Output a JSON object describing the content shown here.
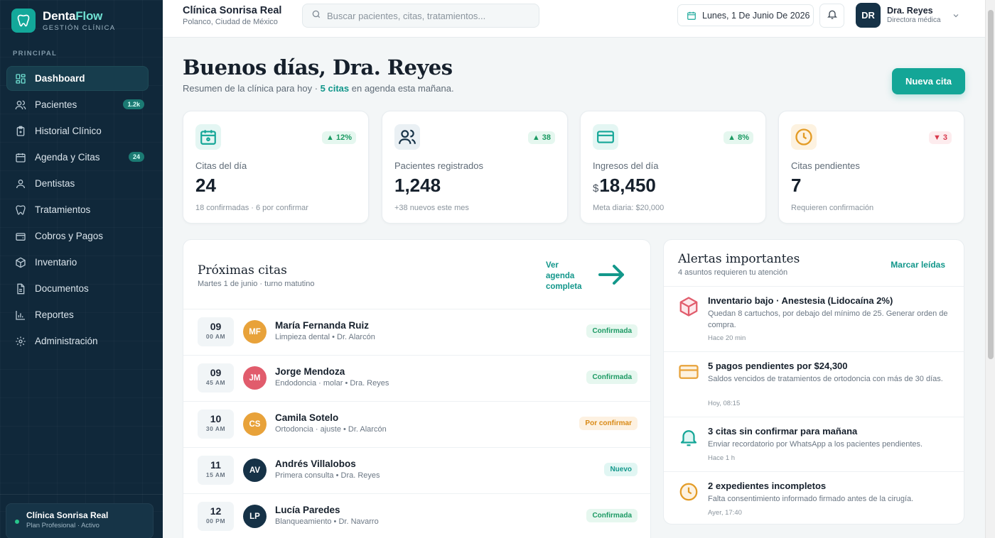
{
  "brand": {
    "name_main": "Denta",
    "name_accent": "Flow",
    "subtitle": "GESTIÓN CLÍNICA"
  },
  "sidebar": {
    "section_label": "PRINCIPAL",
    "items": [
      {
        "label": "Dashboard",
        "icon": "dashboard-icon",
        "active": true
      },
      {
        "label": "Pacientes",
        "icon": "users-icon",
        "badge": "1.2k"
      },
      {
        "label": "Historial Clínico",
        "icon": "clipboard-icon"
      },
      {
        "label": "Agenda y Citas",
        "icon": "calendar-icon",
        "badge": "24"
      },
      {
        "label": "Dentistas",
        "icon": "user-icon"
      },
      {
        "label": "Tratamientos",
        "icon": "tooth-icon"
      },
      {
        "label": "Cobros y Pagos",
        "icon": "wallet-icon"
      },
      {
        "label": "Inventario",
        "icon": "box-icon"
      },
      {
        "label": "Documentos",
        "icon": "document-icon"
      },
      {
        "label": "Reportes",
        "icon": "bar-chart-icon"
      },
      {
        "label": "Administración",
        "icon": "gear-icon"
      }
    ],
    "footer": {
      "clinic": "Clínica Sonrisa Real",
      "plan": "Plan Profesional · Activo"
    }
  },
  "header": {
    "clinic_name": "Clínica Sonrisa Real",
    "clinic_location": "Polanco, Ciudad de México",
    "search_placeholder": "Buscar pacientes, citas, tratamientos...",
    "date": "Lunes, 1 De Junio De 2026",
    "user_initials": "DR",
    "user_name": "Dra. Reyes",
    "user_role": "Directora médica"
  },
  "main": {
    "greeting": "Buenos días, Dra. Reyes",
    "summary_prefix": "Resumen de la clínica para hoy · ",
    "summary_highlight": "5 citas",
    "summary_suffix": " en agenda esta mañana.",
    "new_appointment_label": "Nueva cita"
  },
  "stats": [
    {
      "label": "Citas del día",
      "value": "24",
      "currency": "",
      "delta": "▲ 12%",
      "trend": "up",
      "note": "18 confirmadas · 6 por confirmar",
      "icon": "calendar-icon",
      "color": "#14a697"
    },
    {
      "label": "Pacientes registrados",
      "value": "1,248",
      "currency": "",
      "delta": "▲ 38",
      "trend": "up",
      "note": "+38 nuevos este mes",
      "icon": "users-icon",
      "color": "#163247"
    },
    {
      "label": "Ingresos del día",
      "value": "18,450",
      "currency": "$",
      "delta": "▲ 8%",
      "trend": "up",
      "note": "Meta diaria: $20,000",
      "icon": "credit-card-icon",
      "color": "#14a697"
    },
    {
      "label": "Citas pendientes",
      "value": "7",
      "currency": "",
      "delta": "▼ 3",
      "trend": "down",
      "note": "Requieren confirmación",
      "icon": "clock-icon",
      "color": "#e39b25"
    }
  ],
  "appointments": {
    "title": "Próximas citas",
    "subtitle": "Martes 1 de junio · turno matutino",
    "see_all": "Ver agenda completa",
    "rows": [
      {
        "hour": "09",
        "minute": "00 AM",
        "initials": "MF",
        "avatar_color": "#e8a23a",
        "name": "María Fernanda Ruiz",
        "detail": "Limpieza dental • Dr. Alarcón",
        "status": "Confirmada",
        "status_type": "ok"
      },
      {
        "hour": "09",
        "minute": "45 AM",
        "initials": "JM",
        "avatar_color": "#e15c6c",
        "name": "Jorge Mendoza",
        "detail": "Endodoncia · molar • Dra. Reyes",
        "status": "Confirmada",
        "status_type": "ok"
      },
      {
        "hour": "10",
        "minute": "30 AM",
        "initials": "CS",
        "avatar_color": "#e8a23a",
        "name": "Camila Sotelo",
        "detail": "Ortodoncia · ajuste • Dr. Alarcón",
        "status": "Por confirmar",
        "status_type": "pend"
      },
      {
        "hour": "11",
        "minute": "15 AM",
        "initials": "AV",
        "avatar_color": "#163247",
        "name": "Andrés Villalobos",
        "detail": "Primera consulta • Dra. Reyes",
        "status": "Nuevo",
        "status_type": "new"
      },
      {
        "hour": "12",
        "minute": "00 PM",
        "initials": "LP",
        "avatar_color": "#163247",
        "name": "Lucía Paredes",
        "detail": "Blanqueamiento • Dr. Navarro",
        "status": "Confirmada",
        "status_type": "ok"
      }
    ]
  },
  "alerts": {
    "title": "Alertas importantes",
    "subtitle": "4 asuntos requieren tu atención",
    "mark_read": "Marcar leídas",
    "items": [
      {
        "title": "Inventario bajo · Anestesia (Lidocaína 2%)",
        "desc": "Quedan 8 cartuchos, por debajo del mínimo de 25. Generar orden de compra.",
        "time": "Hace 20 min",
        "icon": "box-icon",
        "color": "#e15c6c"
      },
      {
        "title": "5 pagos pendientes por $24,300",
        "desc": "Saldos vencidos de tratamientos de ortodoncia con más de 30 días.",
        "time": "Hoy, 08:15",
        "icon": "credit-card-icon",
        "color": "#e8a23a"
      },
      {
        "title": "3 citas sin confirmar para mañana",
        "desc": "Enviar recordatorio por WhatsApp a los pacientes pendientes.",
        "time": "Hace 1 h",
        "icon": "bell-icon",
        "color": "#14a697"
      },
      {
        "title": "2 expedientes incompletos",
        "desc": "Falta consentimiento informado firmado antes de la cirugía.",
        "time": "Ayer, 17:40",
        "icon": "clock-icon",
        "color": "#e39b25"
      }
    ]
  }
}
